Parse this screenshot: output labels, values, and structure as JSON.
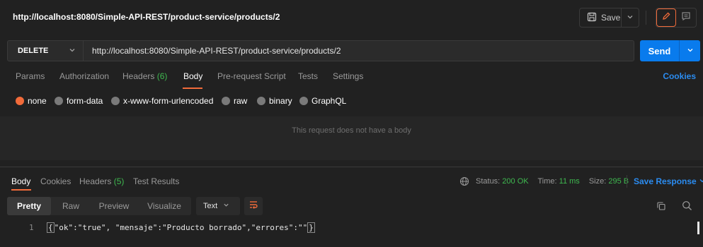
{
  "header": {
    "title": "http://localhost:8080/Simple-API-REST/product-service/products/2",
    "save_label": "Save",
    "icons": [
      "save-icon",
      "chevron-down-icon",
      "pencil-icon",
      "comment-icon"
    ]
  },
  "request": {
    "method": "DELETE",
    "url": "http://localhost:8080/Simple-API-REST/product-service/products/2",
    "send_label": "Send"
  },
  "request_tabs": {
    "params": "Params",
    "authorization": "Authorization",
    "headers": "Headers",
    "headers_count": "(6)",
    "body": "Body",
    "pre_request": "Pre-request Script",
    "tests": "Tests",
    "settings": "Settings",
    "active": "Body",
    "cookies": "Cookies"
  },
  "body_types": {
    "options": [
      "none",
      "form-data",
      "x-www-form-urlencoded",
      "raw",
      "binary",
      "GraphQL"
    ],
    "selected": "none"
  },
  "body_message": "This request does not have a body",
  "response": {
    "tabs": {
      "body": "Body",
      "cookies": "Cookies",
      "headers": "Headers",
      "headers_count": "(5)",
      "test_results": "Test Results",
      "active": "Body"
    },
    "status_label": "Status:",
    "status_value": "200 OK",
    "time_label": "Time:",
    "time_value": "11 ms",
    "size_label": "Size:",
    "size_value": "295 B",
    "save_response": "Save Response",
    "views": [
      "Pretty",
      "Raw",
      "Preview",
      "Visualize"
    ],
    "active_view": "Pretty",
    "format": "Text",
    "line_number": "1",
    "code_open": "{",
    "code_content": "\"ok\":\"true\", \"mensaje\":\"Producto borrado\",\"errores\":\"\"",
    "code_close": "}"
  },
  "colors": {
    "background": "#212121",
    "accent_orange": "#f26b3a",
    "send_blue": "#097bed",
    "link_blue": "#2b8cf0",
    "status_green": "#3fb950"
  }
}
